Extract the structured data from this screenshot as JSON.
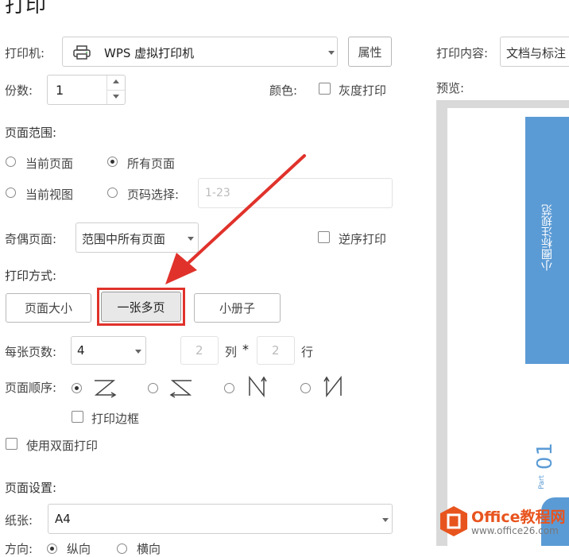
{
  "dialog": {
    "title": "打印"
  },
  "printer": {
    "label": "打印机:",
    "value": "WPS 虚拟打印机",
    "props_button": "属性"
  },
  "copies": {
    "label": "份数:",
    "value": "1"
  },
  "color": {
    "label": "颜色:",
    "grayscale_label": "灰度打印"
  },
  "page_range": {
    "heading": "页面范围:",
    "current_page": "当前页面",
    "all_pages": "所有页面",
    "current_view": "当前视图",
    "page_select": "页码选择:",
    "page_select_placeholder": "1-23",
    "selected": "all_pages"
  },
  "odd_even": {
    "label": "奇偶页面:",
    "value": "范围中所有页面",
    "reverse_label": "逆序打印"
  },
  "print_mode": {
    "heading": "打印方式:",
    "buttons": [
      "页面大小",
      "一张多页",
      "小册子"
    ],
    "selected": "一张多页"
  },
  "pages_per_sheet": {
    "label": "每张页数:",
    "value": "4",
    "cols": "2",
    "cols_label": "列",
    "times": "*",
    "rows": "2",
    "rows_label": "行"
  },
  "page_order": {
    "label": "页面顺序:",
    "selected_index": 0
  },
  "print_border": {
    "label": "打印边框"
  },
  "duplex": {
    "label": "使用双面打印"
  },
  "page_setup": {
    "heading": "页面设置:",
    "paper_label": "纸张:",
    "paper_value": "A4",
    "orientation_label": "方向:",
    "portrait": "纵向",
    "landscape": "横向"
  },
  "right_panel": {
    "content_label": "打印内容:",
    "content_value": "文档与标注",
    "preview_label": "预览:",
    "preview_banner_text": "小圈标注规范",
    "preview_part_label": "Part",
    "preview_part_number": "01"
  },
  "watermark": {
    "brand": "Office教程网",
    "url": "www.office26.com"
  },
  "colors": {
    "accent_blue": "#5b9bd5",
    "highlight_red": "#e0322b",
    "logo_orange": "#e8541e"
  }
}
